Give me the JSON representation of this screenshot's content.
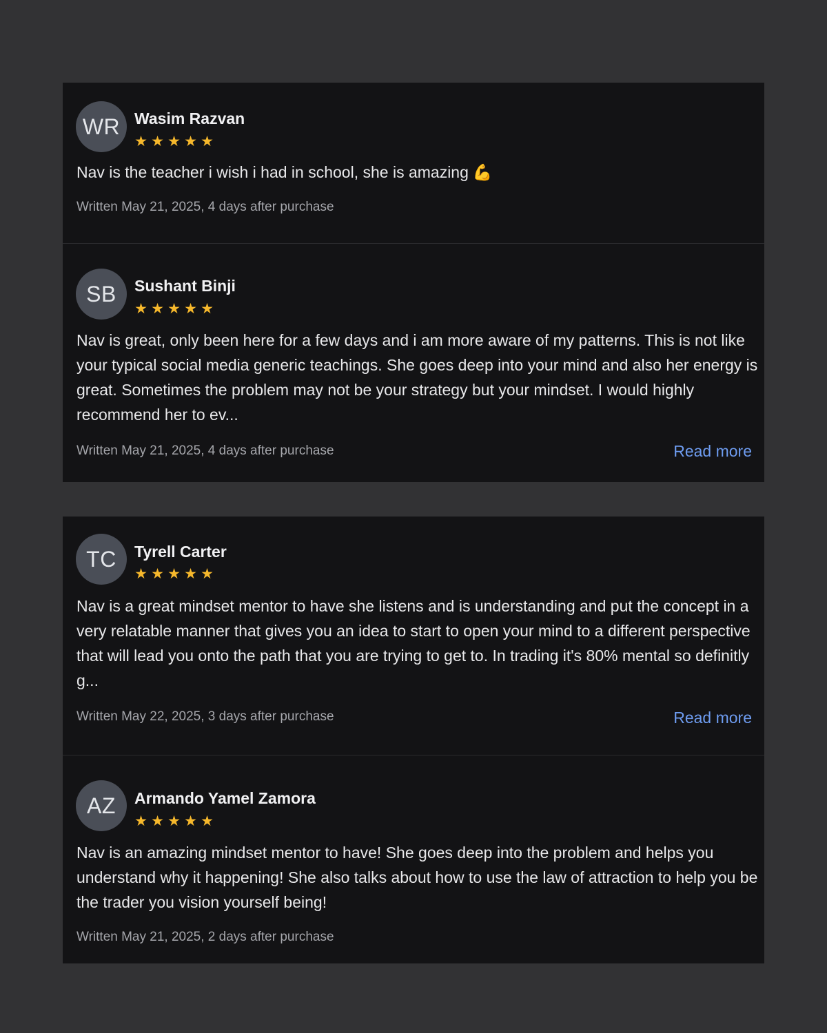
{
  "reviews": [
    {
      "initials": "WR",
      "name": "Wasim Razvan",
      "rating": 5,
      "text": "Nav is the teacher i wish i had in school, she is amazing",
      "emoji": "💪",
      "meta": "Written May 21, 2025, 4 days after purchase"
    },
    {
      "initials": "SB",
      "name": "Sushant Binji",
      "rating": 5,
      "text": "Nav is great, only been here for a few days and i am more aware of my patterns. This is not like your typical social media generic teachings. She goes deep into your mind and also her energy is great. Sometimes the problem may not be your strategy but your mindset. I would highly recommend her to ev...",
      "meta": "Written May 21, 2025, 4 days after purchase",
      "read_more": "Read more"
    },
    {
      "initials": "TC",
      "name": "Tyrell Carter",
      "rating": 5,
      "text": "Nav is a great mindset mentor to have she listens and is understanding and put the concept in a very relatable manner that gives you an idea to start to open your mind to a different perspective that will lead you onto the path that you are trying to get to. In trading it's 80% mental so definitly g...",
      "meta": "Written May 22, 2025, 3 days after purchase",
      "read_more": "Read more"
    },
    {
      "initials": "AZ",
      "name": "Armando Yamel Zamora",
      "rating": 5,
      "text": "Nav is an amazing mindset mentor to have! She goes deep into the problem and helps you understand why it happening! She also talks about how to use the law of attraction to help you be the trader you vision yourself being!",
      "meta": "Written May 21, 2025, 2 days after purchase"
    }
  ],
  "colors": {
    "background": "#323234",
    "card": "#131315",
    "star": "#f6b82c",
    "link": "#6e9cf0",
    "avatar": "#4a4e57"
  },
  "icons": {
    "star": "star-icon"
  }
}
